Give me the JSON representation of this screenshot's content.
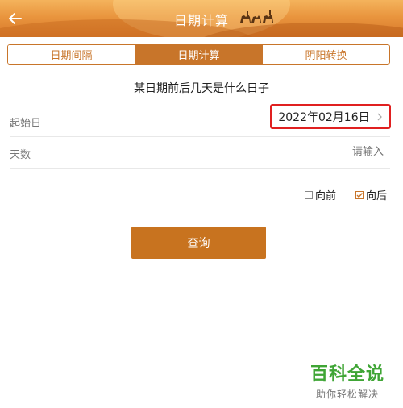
{
  "header": {
    "title": "日期计算",
    "back_icon": "arrow-left-icon",
    "decoration_icon": "camel-caravan-icon"
  },
  "tabs": [
    {
      "label": "日期间隔",
      "active": false
    },
    {
      "label": "日期计算",
      "active": true
    },
    {
      "label": "阴阳转换",
      "active": false
    }
  ],
  "subtitle": "某日期前后几天是什么日子",
  "form": {
    "start_label": "起始日",
    "start_value": "2022年02月16日",
    "days_label": "天数",
    "days_placeholder": "请输入"
  },
  "options": {
    "before_label": "向前",
    "before_checked": false,
    "after_label": "向后",
    "after_checked": true
  },
  "query_button": "查询",
  "watermark": {
    "main": "百科全说",
    "sub": "助你轻松解决"
  },
  "colors": {
    "accent": "#c8752a",
    "highlight_border": "#e02020",
    "watermark_green": "#3fa535"
  }
}
